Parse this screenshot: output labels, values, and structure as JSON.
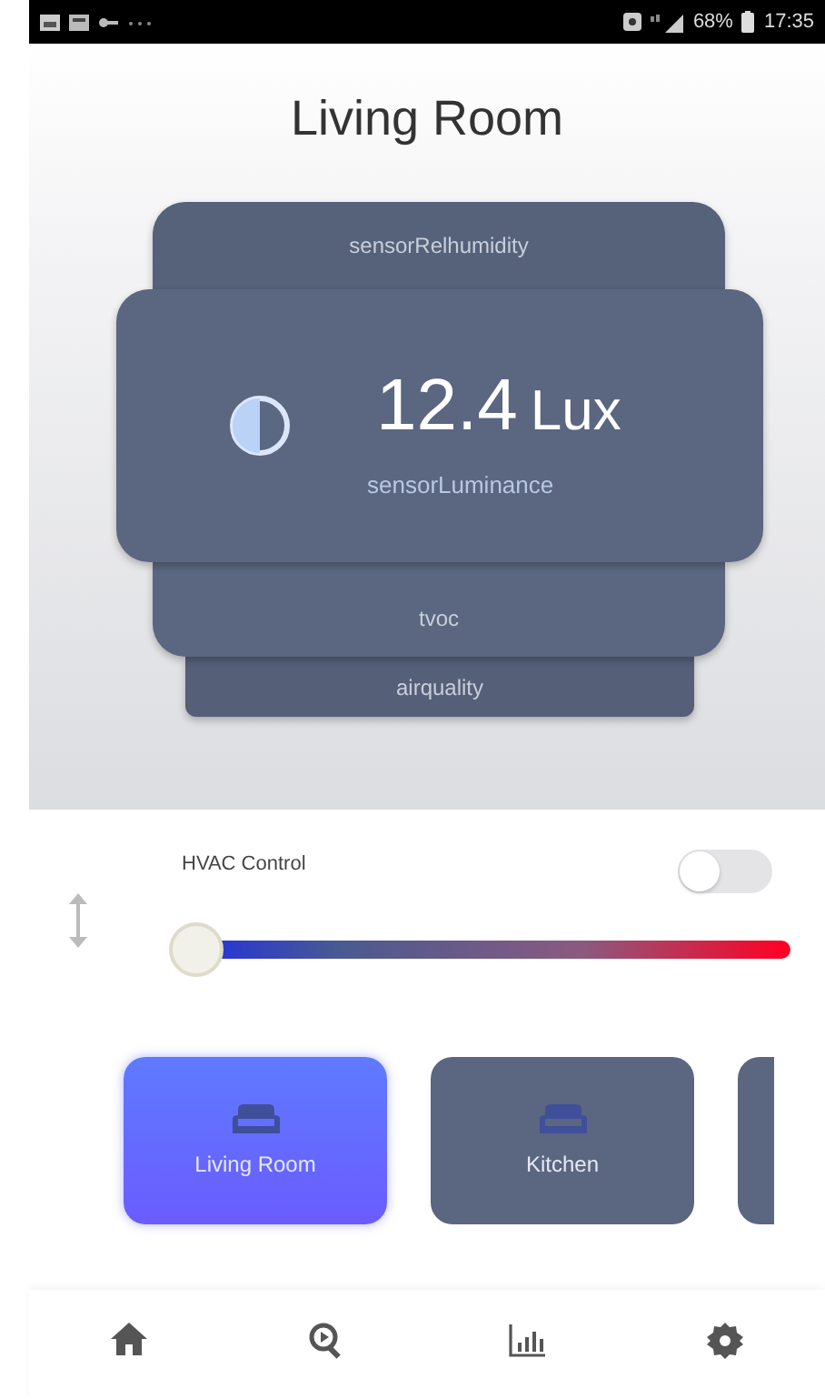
{
  "status_bar": {
    "battery": "68%",
    "time": "17:35"
  },
  "title": "Living Room",
  "sensors": [
    {
      "name": "sensorRelhumidity",
      "selected": false
    },
    {
      "name": "sensorLuminance",
      "value": "12.4",
      "unit": "Lux",
      "selected": true
    },
    {
      "name": "tvoc",
      "selected": false
    },
    {
      "name": "airquality",
      "selected": false
    }
  ],
  "hvac": {
    "label": "HVAC Control",
    "on": false,
    "level": 0.0
  },
  "rooms": [
    {
      "label": "Living Room",
      "selected": true
    },
    {
      "label": "Kitchen",
      "selected": false
    }
  ],
  "nav": [
    {
      "kind": "home"
    },
    {
      "kind": "search"
    },
    {
      "kind": "chart"
    },
    {
      "kind": "settings"
    }
  ]
}
